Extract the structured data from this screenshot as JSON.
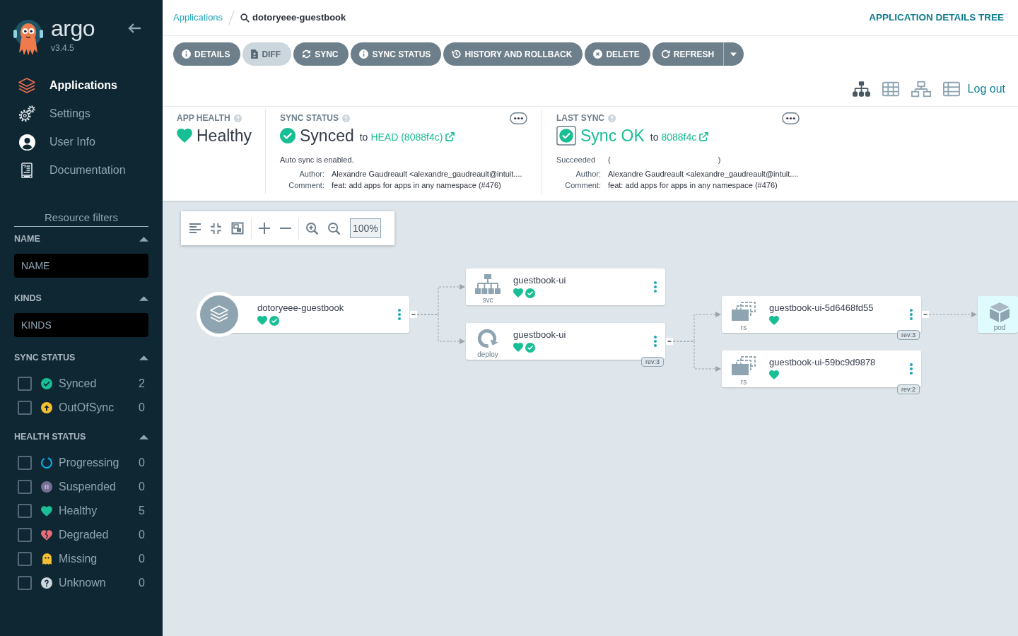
{
  "sidebar": {
    "logo": {
      "wordmark": "argo",
      "version": "v3.4.5"
    },
    "nav": [
      {
        "kind": "applications",
        "label": "Applications",
        "selected": true
      },
      {
        "kind": "settings",
        "label": "Settings",
        "selected": false
      },
      {
        "kind": "user",
        "label": "User Info",
        "selected": false
      },
      {
        "kind": "docs",
        "label": "Documentation",
        "selected": false
      }
    ],
    "filters": {
      "title": "Resource filters",
      "groups": [
        {
          "kind": "text",
          "label": "NAME",
          "expanded": true,
          "placeholder": "NAME"
        },
        {
          "kind": "text",
          "label": "KINDS",
          "expanded": true,
          "placeholder": "KINDS"
        },
        {
          "kind": "checklist",
          "label": "SYNC STATUS",
          "expanded": true,
          "items": [
            {
              "kind": "synced",
              "label": "Synced",
              "count": "2",
              "checked": false
            },
            {
              "kind": "out_of_sync",
              "label": "OutOfSync",
              "count": "0",
              "checked": false
            }
          ]
        },
        {
          "kind": "checklist",
          "label": "HEALTH STATUS",
          "expanded": true,
          "items": [
            {
              "kind": "progressing",
              "label": "Progressing",
              "count": "0",
              "checked": false
            },
            {
              "kind": "suspended",
              "label": "Suspended",
              "count": "0",
              "checked": false
            },
            {
              "kind": "healthy",
              "label": "Healthy",
              "count": "5",
              "checked": false
            },
            {
              "kind": "degraded",
              "label": "Degraded",
              "count": "0",
              "checked": false
            },
            {
              "kind": "missing",
              "label": "Missing",
              "count": "0",
              "checked": false
            },
            {
              "kind": "unknown",
              "label": "Unknown",
              "count": "0",
              "checked": false
            }
          ]
        }
      ]
    }
  },
  "header": {
    "breadcrumb": [
      {
        "kind": "link",
        "label": "Applications"
      },
      {
        "kind": "search",
        "label": "dotoryeee-guestbook"
      }
    ],
    "title": "APPLICATION DETAILS TREE"
  },
  "actions": [
    {
      "kind": "details",
      "label": "DETAILS",
      "disabled": false,
      "dropdown": false
    },
    {
      "kind": "diff",
      "label": "DIFF",
      "disabled": true,
      "dropdown": false
    },
    {
      "kind": "sync",
      "label": "SYNC",
      "disabled": false,
      "dropdown": false
    },
    {
      "kind": "sync-status",
      "label": "SYNC STATUS",
      "disabled": false,
      "dropdown": false
    },
    {
      "kind": "history",
      "label": "HISTORY AND ROLLBACK",
      "disabled": false,
      "dropdown": false
    },
    {
      "kind": "delete",
      "label": "DELETE",
      "disabled": false,
      "dropdown": false
    },
    {
      "kind": "refresh",
      "label": "REFRESH",
      "disabled": false,
      "dropdown": true
    }
  ],
  "view_modes": [
    {
      "kind": "tree",
      "selected": true
    },
    {
      "kind": "pods",
      "selected": false
    },
    {
      "kind": "network",
      "selected": false
    },
    {
      "kind": "list",
      "selected": false
    }
  ],
  "logout": "Log out",
  "status_panel": {
    "app_health": {
      "label": "APP HEALTH",
      "kind": "healthy",
      "value": "Healthy"
    },
    "sync_status": {
      "label": "SYNC STATUS",
      "kind": "synced",
      "value": "Synced",
      "to": "to",
      "revision": "HEAD (8088f4c)",
      "message": "Auto sync is enabled.",
      "details": [
        {
          "label": "Author:",
          "value": "Alexandre Gaudreault <alexandre_gaudreault@intuit...."
        },
        {
          "label": "Comment:",
          "value": "feat: add apps for apps in any namespace (#476)"
        }
      ]
    },
    "last_sync": {
      "label": "LAST SYNC",
      "kind": "succeeded",
      "value": "Sync OK",
      "to": "to",
      "revision": "8088f4c",
      "phase": "Succeeded",
      "time_brackets": [
        "(",
        ")"
      ],
      "details": [
        {
          "label": "Author:",
          "value": "Alexandre Gaudreault <alexandre_gaudreault@intuit...."
        },
        {
          "label": "Comment:",
          "value": "feat: add apps for apps in any namespace (#476)"
        }
      ]
    }
  },
  "graph": {
    "zoom": "100%",
    "tree": {
      "kind": "application",
      "name": "dotoryeee-guestbook",
      "statuses": [
        {
          "kind": "healthy"
        },
        {
          "kind": "synced"
        }
      ],
      "expanded": true,
      "children": [
        {
          "kind": "svc",
          "type_label": "svc",
          "name": "guestbook-ui",
          "statuses": [
            {
              "kind": "healthy"
            },
            {
              "kind": "synced"
            }
          ]
        },
        {
          "kind": "deploy",
          "type_label": "deploy",
          "name": "guestbook-ui",
          "statuses": [
            {
              "kind": "healthy"
            },
            {
              "kind": "synced"
            }
          ],
          "revision": "rev:3",
          "expanded": true,
          "children": [
            {
              "kind": "rs",
              "type_label": "rs",
              "name": "guestbook-ui-5d6468fd55",
              "statuses": [
                {
                  "kind": "healthy"
                }
              ],
              "revision": "rev:3",
              "expanded": true,
              "children": [
                {
                  "kind": "pod",
                  "type_label": "pod"
                }
              ]
            },
            {
              "kind": "rs",
              "type_label": "rs",
              "name": "guestbook-ui-59bc9d9878",
              "statuses": [
                {
                  "kind": "healthy"
                }
              ],
              "revision": "rev:2"
            }
          ]
        }
      ]
    }
  }
}
